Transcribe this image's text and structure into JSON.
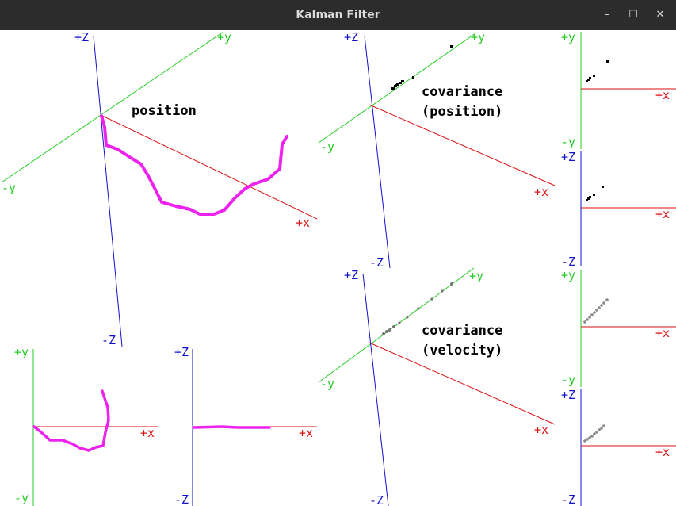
{
  "window": {
    "title": "Kalman Filter",
    "controls": {
      "minimize": "–",
      "maximize": "☐",
      "close": "✕"
    }
  },
  "colors": {
    "x_axis": "#dd1111",
    "y_axis": "#22cc22",
    "z_axis": "#1111cc",
    "trajectory": "#ee22ee",
    "position_cov_points": "#000000",
    "velocity_cov_points": "#888888"
  },
  "labels": {
    "position": "position",
    "cov_position_line1": "covariance",
    "cov_position_line2": "(position)",
    "cov_velocity_line1": "covariance",
    "cov_velocity_line2": "(velocity)"
  },
  "axes": {
    "pos_plus_z": "+Z",
    "pos_minus_z": "-Z",
    "pos_plus_y": "+y",
    "pos_minus_y": "-y",
    "pos_plus_x": "+x",
    "xy_plus_y": "+y",
    "xy_minus_y": "-y",
    "xy_plus_x": "+x",
    "xz_plus_z": "+Z",
    "xz_minus_z": "-Z",
    "xz_plus_x": "+x",
    "cp_plus_z": "+Z",
    "cp_minus_z": "-Z",
    "cp_plus_y": "+y",
    "cp_minus_y": "-y",
    "cp_plus_x": "+x",
    "cv_plus_z": "+Z",
    "cv_minus_z": "-Z",
    "cv_plus_y": "+y",
    "cv_minus_y": "-y",
    "cv_plus_x": "+x",
    "sp1_plus_y": "+y",
    "sp1_minus_y": "-y",
    "sp1_plus_x": "+x",
    "sp2_plus_z": "+Z",
    "sp2_minus_z": "-Z",
    "sp2_plus_x": "+x",
    "sv1_plus_y": "+y",
    "sv1_minus_y": "-y",
    "sv1_plus_x": "+x",
    "sv2_plus_z": "+Z",
    "sv2_minus_z": "-Z",
    "sv2_plus_x": "+x"
  }
}
